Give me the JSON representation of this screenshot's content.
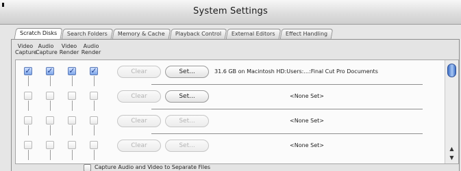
{
  "window": {
    "title": "System Settings"
  },
  "tabs": [
    {
      "label": "Scratch Disks",
      "active": true
    },
    {
      "label": "Search Folders",
      "active": false
    },
    {
      "label": "Memory & Cache",
      "active": false
    },
    {
      "label": "Playback Control",
      "active": false
    },
    {
      "label": "External Editors",
      "active": false
    },
    {
      "label": "Effect Handling",
      "active": false
    }
  ],
  "columns": [
    {
      "line1": "Video",
      "line2": "Capture"
    },
    {
      "line1": "Audio",
      "line2": "Capture"
    },
    {
      "line1": "Video",
      "line2": "Render"
    },
    {
      "line1": "Audio",
      "line2": "Render"
    }
  ],
  "rows": [
    {
      "checks": [
        true,
        true,
        true,
        true
      ],
      "clear_label": "Clear",
      "clear_enabled": false,
      "set_label": "Set...",
      "set_enabled": true,
      "path": "31.6 GB on Macintosh HD:Users:...:Final Cut Pro Documents"
    },
    {
      "checks": [
        false,
        false,
        false,
        false
      ],
      "clear_label": "Clear",
      "clear_enabled": false,
      "set_label": "Set...",
      "set_enabled": true,
      "path": "<None Set>"
    },
    {
      "checks": [
        false,
        false,
        false,
        false
      ],
      "clear_label": "Clear",
      "clear_enabled": false,
      "set_label": "Set...",
      "set_enabled": false,
      "path": "<None Set>"
    },
    {
      "checks": [
        false,
        false,
        false,
        false
      ],
      "clear_label": "Clear",
      "clear_enabled": false,
      "set_label": "Set...",
      "set_enabled": false,
      "path": "<None Set>"
    }
  ],
  "footer": {
    "label": "Capture Audio and Video to Separate Files",
    "checked": false
  },
  "colors": {
    "thumb": "#5a8ad8",
    "check": "#1f3f8f"
  }
}
